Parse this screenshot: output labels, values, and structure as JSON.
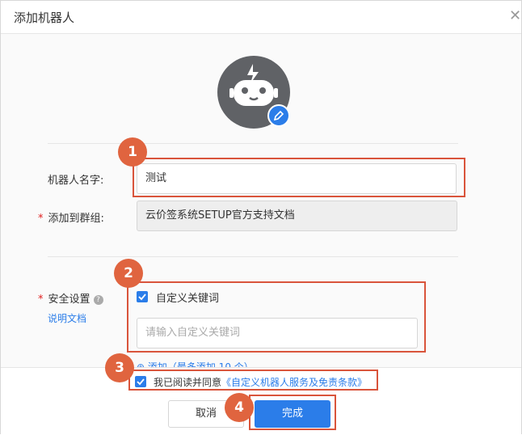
{
  "dialog": {
    "title": "添加机器人"
  },
  "form": {
    "name_label": "机器人名字:",
    "name_value": "测试",
    "group_label": "添加到群组:",
    "group_value": "云价签系统SETUP官方支持文档",
    "security_label": "安全设置",
    "doc_link": "说明文档",
    "keyword_checkbox_label": "自定义关键词",
    "keyword_placeholder": "请输入自定义关键词",
    "add_more_partial": "⊕ 添加（最多添加 10 个）",
    "agree_text": "我已阅读并同意",
    "agree_link": "《自定义机器人服务及免责条款》"
  },
  "buttons": {
    "cancel": "取消",
    "done": "完成"
  },
  "steps": [
    "1",
    "2",
    "3",
    "4"
  ],
  "colors": {
    "accent": "#2b7de9",
    "annotation": "#e0643f",
    "avatar_bg": "#606266"
  }
}
